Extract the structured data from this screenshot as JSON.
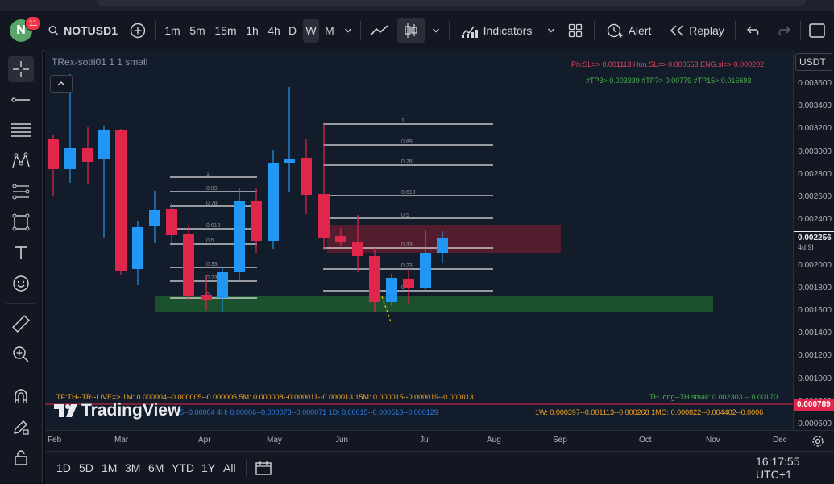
{
  "toolbar": {
    "avatar_letter": "N",
    "notif_count": "11",
    "symbol": "NOTUSD1",
    "timeframes": [
      "1m",
      "5m",
      "15m",
      "1h",
      "4h",
      "D",
      "W",
      "M"
    ],
    "active_timeframe": "W",
    "indicators_label": "Indicators",
    "alert_label": "Alert",
    "replay_label": "Replay"
  },
  "chart": {
    "indicator_title": "TRex-sotti01 1 1 small",
    "sl_line": "Piv.SL=> 0.001113  Hun.SL=> 0.000553  ENG.sl=> 0.000202",
    "tp_line": "#TP3> 0.003339  #TP7> 0.00779  #TP15> 0.016693",
    "tf_line": "TF:TH--TR--LIVE=>  1M: 0.000004--0.000005--0.000005    5M: 0.000008--0.000011--0.000013    15M: 0.000015--0.000019--0.000013",
    "th_line": "TH.long--TH.small: 0.002303 -- 0.00170",
    "row2_line": "5--0.00004      4H: 0.00006--0.000073--0.000071      1D: 0.00015--0.000518--0.000129",
    "row2_right": "1W: 0.000397--0.001113--0.000268      1MO: 0.000822--0.004402--0.0006",
    "watermark": "TradingView",
    "fib_left": [
      "1",
      "0.89",
      "0.78",
      "0.618",
      "0.5",
      "0.33",
      "0.23",
      "0"
    ],
    "fib_right": [
      "1",
      "0.89",
      "0.78",
      "0.618",
      "0.5",
      "0.33",
      "0.23",
      "0"
    ]
  },
  "price_axis": {
    "currency": "USDT",
    "labels": [
      "0.003600",
      "0.003400",
      "0.003200",
      "0.003000",
      "0.002800",
      "0.002600",
      "0.002400",
      "0.002200",
      "0.002000",
      "0.001800",
      "0.001600",
      "0.001400",
      "0.001200",
      "0.001000",
      "0.000800",
      "0.000600"
    ],
    "current_price": "0.002256",
    "countdown": "4d 9h",
    "red_price": "0.000789"
  },
  "time_axis": {
    "labels": [
      "Feb",
      "Mar",
      "Apr",
      "May",
      "Jun",
      "Jul",
      "Aug",
      "Sep",
      "Oct",
      "Nov",
      "Dec"
    ]
  },
  "bottom": {
    "ranges": [
      "1D",
      "5D",
      "1M",
      "3M",
      "6M",
      "YTD",
      "1Y",
      "All"
    ],
    "clock": "16:17:55 UTC+1"
  },
  "colors": {
    "up": "#2196f3",
    "down": "#e0264b",
    "bg": "#131c2b",
    "green_zone": "#1f5a2e",
    "red_zone": "#6b1d2f"
  }
}
